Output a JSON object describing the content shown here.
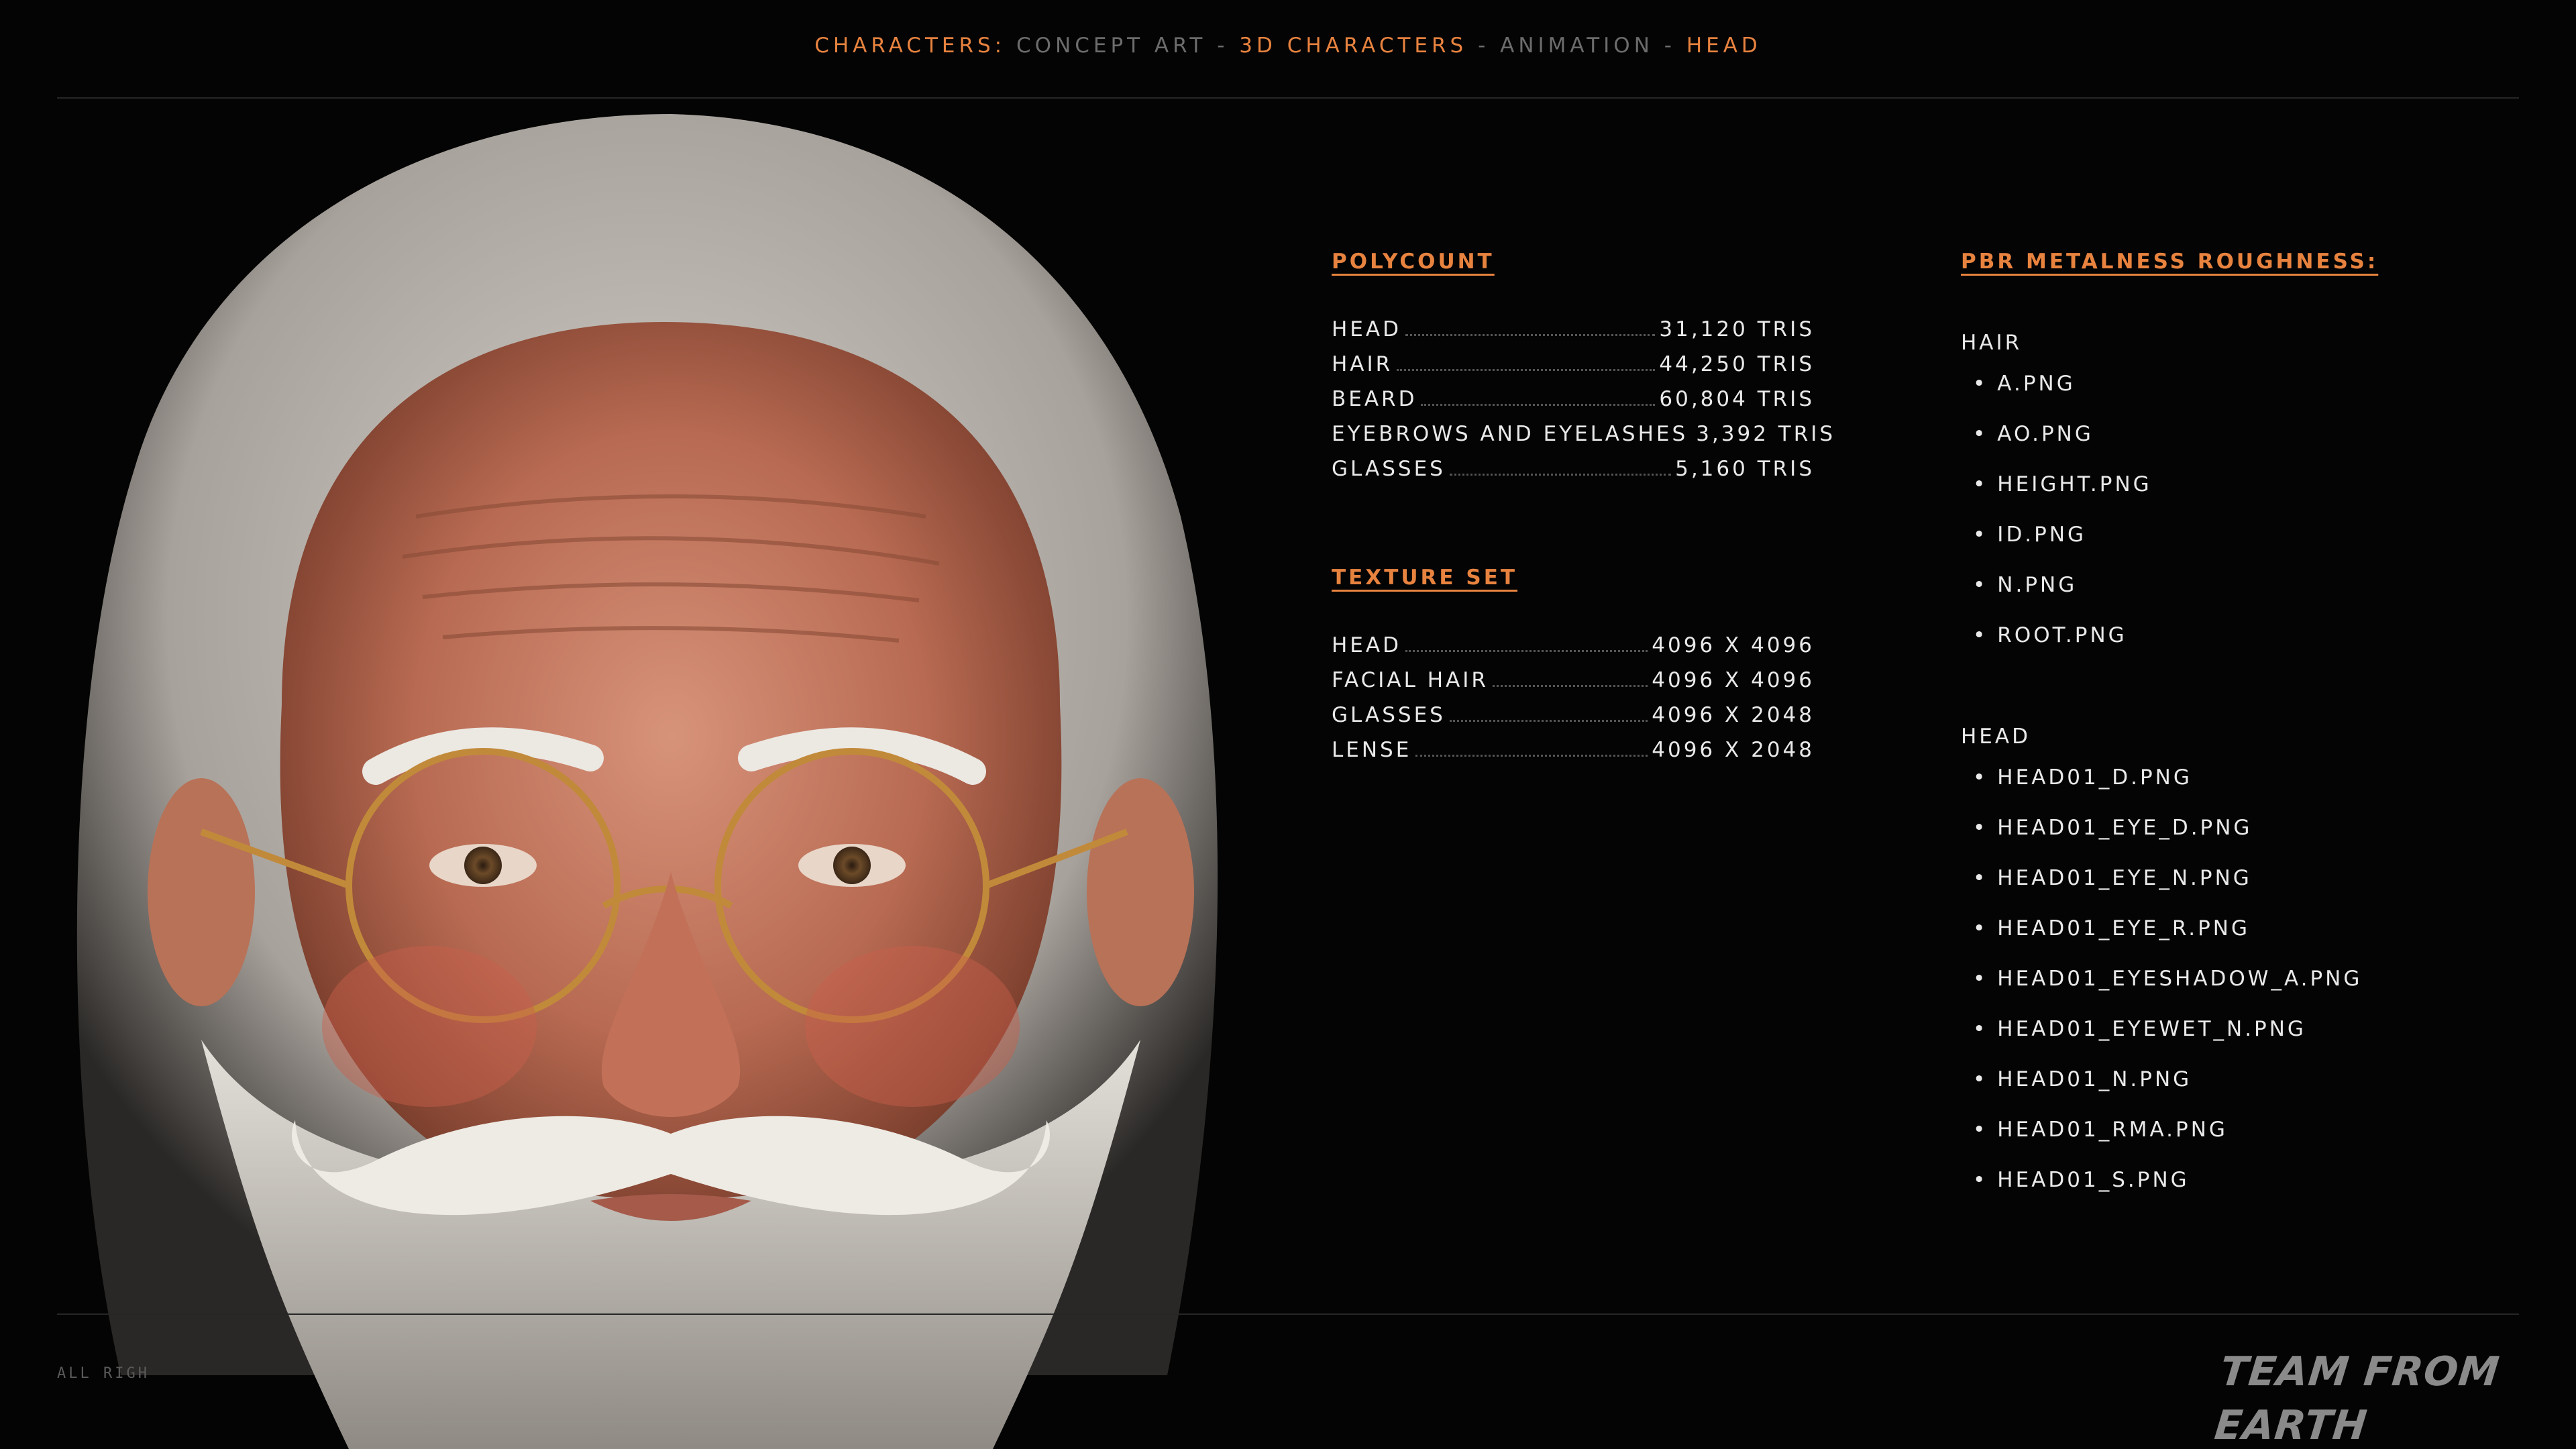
{
  "breadcrumb": {
    "label": "CHARACTERS:",
    "concept_art": "CONCEPT ART",
    "sep": " - ",
    "chars_3d": "3D CHARACTERS",
    "animation": "ANIMATION",
    "head": "HEAD"
  },
  "polycount": {
    "title": "POLYCOUNT",
    "rows": [
      {
        "name": "HEAD",
        "value": "31,120 TRIS"
      },
      {
        "name": "HAIR",
        "value": "44,250 TRIS"
      },
      {
        "name": "BEARD",
        "value": "60,804 TRIS"
      },
      {
        "name": "EYEBROWS AND EYELASHES",
        "value": "3,392 TRIS"
      },
      {
        "name": "GLASSES",
        "value": "5,160 TRIS"
      }
    ]
  },
  "texture_set": {
    "title": "TEXTURE SET",
    "rows": [
      {
        "name": "HEAD",
        "value": "4096 X 4096"
      },
      {
        "name": "FACIAL HAIR",
        "value": "4096 X 4096"
      },
      {
        "name": "GLASSES",
        "value": "4096 X 2048"
      },
      {
        "name": "LENSE",
        "value": "4096 X 2048"
      }
    ]
  },
  "pbr": {
    "title": "PBR METALNESS ROUGHNESS:",
    "hair_label": "HAIR",
    "hair_files": [
      "A.PNG",
      "AO.PNG",
      "HEIGHT.PNG",
      "ID.PNG",
      "N.PNG",
      "ROOT.PNG"
    ],
    "head_label": "HEAD",
    "head_files": [
      "HEAD01_D.PNG",
      "HEAD01_EYE_D.PNG",
      "HEAD01_EYE_N.PNG",
      "HEAD01_EYE_R.PNG",
      "HEAD01_EYESHADOW_A.PNG",
      "HEAD01_EYEWET_N.PNG",
      "HEAD01_N.PNG",
      "HEAD01_RMA.PNG",
      "HEAD01_S.PNG"
    ]
  },
  "footer": {
    "rights": "ALL RIGH",
    "logo": "TEAM FROM EARTH"
  },
  "colors": {
    "accent": "#e8833f",
    "background": "#040404",
    "text": "#e9e9e9",
    "muted": "#6c6c6c"
  }
}
